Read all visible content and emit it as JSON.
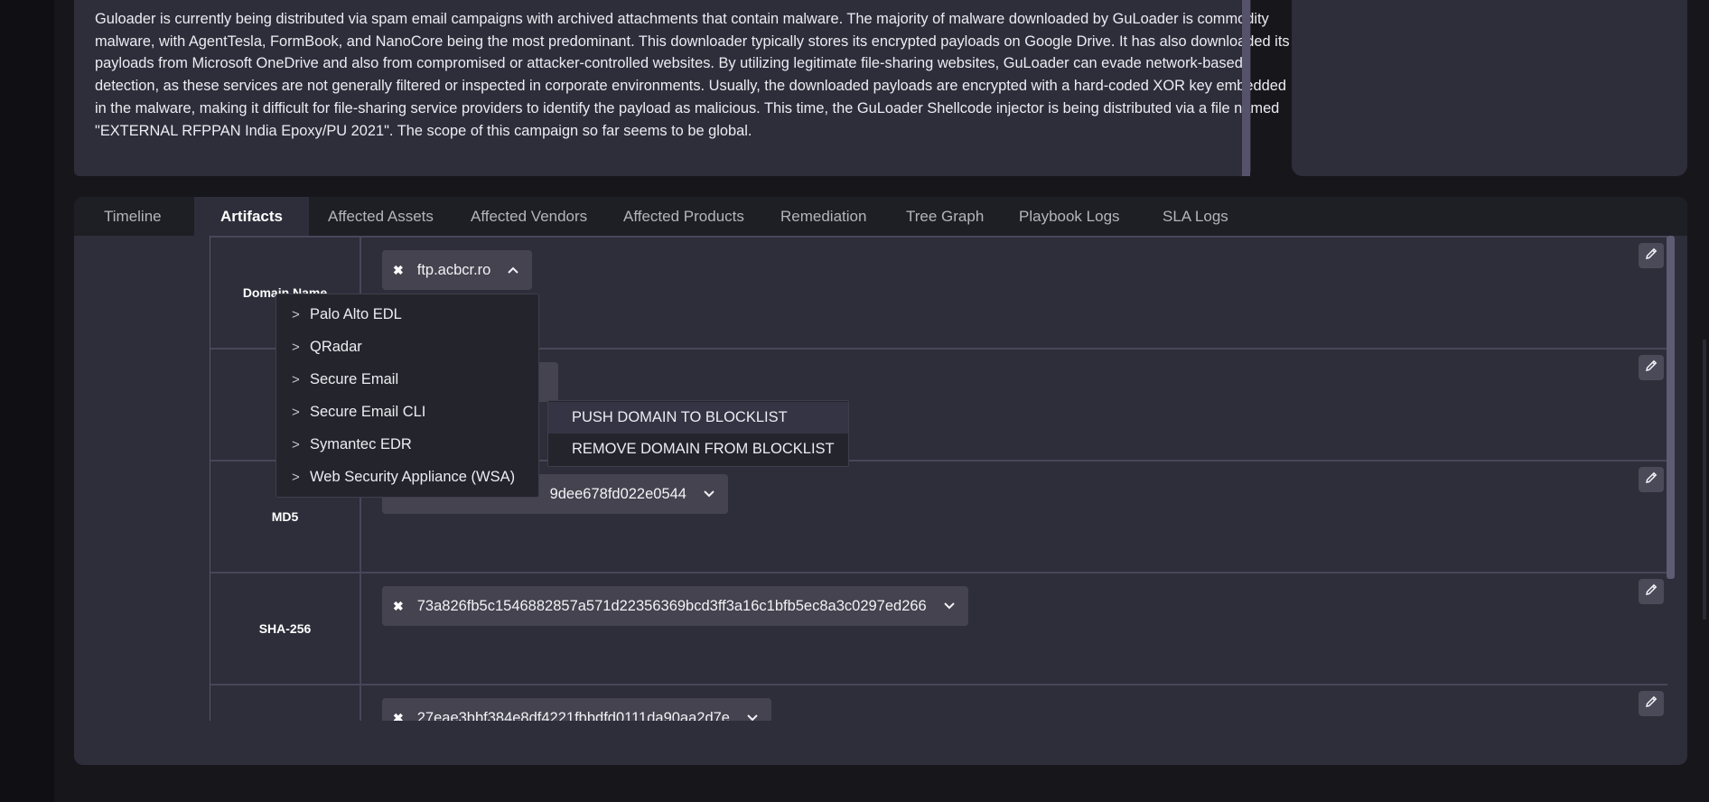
{
  "description": {
    "text": "Guloader is currently being distributed via spam email campaigns with archived attachments that contain malware. The majority of malware downloaded by GuLoader is commodity malware, with AgentTesla, FormBook, and NanoCore being the most predominant. This downloader typically stores its encrypted payloads on Google Drive. It has also downloaded its payloads from Microsoft OneDrive and also from compromised or attacker-controlled websites. By utilizing legitimate file-sharing websites, GuLoader can evade network-based detection, as these services are not generally filtered or inspected in corporate environments. Usually, the downloaded payloads are encrypted with a hard-coded XOR key embedded in the malware, making it difficult for file-sharing service providers to identify the payload as malicious. This time, the GuLoader Shellcode injector is being distributed via a file named \"EXTERNAL RFPPAN India Epoxy/PU 2021\". The scope of this campaign so far seems to be global."
  },
  "tabs": [
    {
      "label": "Timeline"
    },
    {
      "label": "Artifacts"
    },
    {
      "label": "Affected Assets"
    },
    {
      "label": "Affected Vendors"
    },
    {
      "label": "Affected Products"
    },
    {
      "label": "Remediation"
    },
    {
      "label": "Tree Graph"
    },
    {
      "label": "Playbook Logs"
    },
    {
      "label": "SLA Logs"
    }
  ],
  "artifacts": [
    {
      "label": "Domain Name",
      "value": "ftp.acbcr.ro",
      "expanded": true
    },
    {
      "label": "E",
      "value": "",
      "expanded": false
    },
    {
      "label": "MD5",
      "value": "9dee678fd022e0544",
      "expanded": false
    },
    {
      "label": "SHA-256",
      "value": "73a826fb5c1546882857a571d22356369bcd3ff3a16c1bfb5ec8a3c0297ed266",
      "expanded": false
    },
    {
      "label": "",
      "value": "27eae3bbf384e8df4221fbbdfd0111da90aa2d7e",
      "expanded": false
    }
  ],
  "dropdown": {
    "items": [
      {
        "label": "Palo Alto EDL"
      },
      {
        "label": "QRadar"
      },
      {
        "label": "Secure Email"
      },
      {
        "label": "Secure Email CLI"
      },
      {
        "label": "Symantec EDR"
      },
      {
        "label": "Web Security Appliance (WSA)"
      }
    ]
  },
  "submenu": {
    "items": [
      {
        "label": "PUSH DOMAIN TO BLOCKLIST"
      },
      {
        "label": "REMOVE DOMAIN FROM BLOCKLIST"
      }
    ]
  },
  "icons": {
    "remove": "close-icon",
    "expand": "chevron-down-icon",
    "collapse": "chevron-up-icon",
    "edit": "pencil-icon",
    "submenu": "chevron-right-icon"
  },
  "colors": {
    "background": "#16161b",
    "panel": "#2e2d3a",
    "chip": "#44434f",
    "menu": "#24242c"
  }
}
